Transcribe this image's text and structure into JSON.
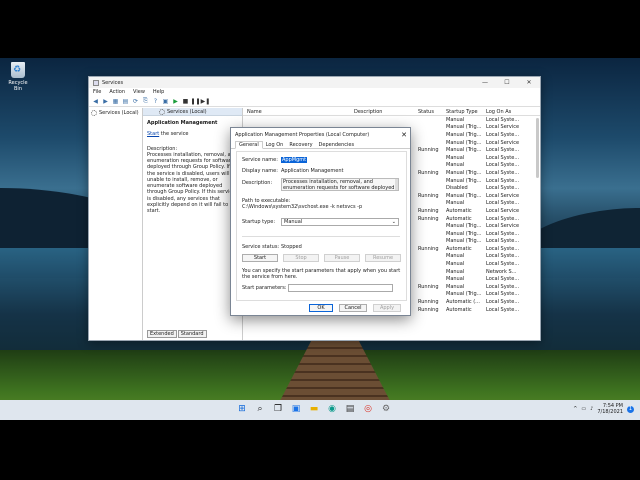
{
  "desktop": {
    "recycle_bin_label": "Recycle Bin"
  },
  "window": {
    "title": "Services",
    "controls": [
      "—",
      "☐",
      "✕"
    ],
    "menu": [
      "File",
      "Action",
      "View",
      "Help"
    ],
    "tree_item": "Services (Local)",
    "mid_header": "Services (Local)",
    "selected_service": "Application Management",
    "start_link": "Start",
    "start_suffix": " the service",
    "description_label": "Description:",
    "description_text": "Processes installation, removal, and enumeration requests for software deployed through Group Policy. If the service is disabled, users will be unable to install, remove, or enumerate software deployed through Group Policy. If this service is disabled, any services that explicitly depend on it will fail to start.",
    "bottom_tabs": [
      "Extended",
      "Standard"
    ],
    "columns": {
      "name": "Name",
      "description": "Description",
      "status": "Status",
      "startup": "Startup Type",
      "logon": "Log On As"
    },
    "rows": [
      {
        "name": "",
        "desc": "",
        "status": "",
        "startup": "Manual",
        "logon": "Local Syste..."
      },
      {
        "name": "",
        "desc": "",
        "status": "",
        "startup": "Manual (Trig...",
        "logon": "Local Service"
      },
      {
        "name": "",
        "desc": "",
        "status": "",
        "startup": "Manual (Trig...",
        "logon": "Local Syste..."
      },
      {
        "name": "",
        "desc": "",
        "status": "",
        "startup": "Manual (Trig...",
        "logon": "Local Service"
      },
      {
        "name": "",
        "desc": "",
        "status": "Running",
        "startup": "Manual (Trig...",
        "logon": "Local Syste..."
      },
      {
        "name": "",
        "desc": "",
        "status": "",
        "startup": "Manual",
        "logon": "Local Syste..."
      },
      {
        "name": "",
        "desc": "",
        "status": "",
        "startup": "Manual",
        "logon": "Local Syste..."
      },
      {
        "name": "",
        "desc": "",
        "status": "Running",
        "startup": "Manual (Trig...",
        "logon": "Local Syste..."
      },
      {
        "name": "",
        "desc": "",
        "status": "",
        "startup": "Manual (Trig...",
        "logon": "Local Syste..."
      },
      {
        "name": "",
        "desc": "",
        "status": "",
        "startup": "Disabled",
        "logon": "Local Syste..."
      },
      {
        "name": "",
        "desc": "",
        "status": "Running",
        "startup": "Manual (Trig...",
        "logon": "Local Service"
      },
      {
        "name": "",
        "desc": "",
        "status": "",
        "startup": "Manual",
        "logon": "Local Syste..."
      },
      {
        "name": "",
        "desc": "",
        "status": "Running",
        "startup": "Automatic",
        "logon": "Local Service"
      },
      {
        "name": "",
        "desc": "",
        "status": "Running",
        "startup": "Automatic",
        "logon": "Local Syste..."
      },
      {
        "name": "",
        "desc": "",
        "status": "",
        "startup": "Manual (Trig...",
        "logon": "Local Service"
      },
      {
        "name": "",
        "desc": "",
        "status": "",
        "startup": "Manual (Trig...",
        "logon": "Local Syste..."
      },
      {
        "name": "",
        "desc": "",
        "status": "",
        "startup": "Manual (Trig...",
        "logon": "Local Syste..."
      },
      {
        "name": "",
        "desc": "",
        "status": "Running",
        "startup": "Automatic",
        "logon": "Local Syste..."
      },
      {
        "name": "",
        "desc": "",
        "status": "",
        "startup": "Manual",
        "logon": "Local Syste..."
      },
      {
        "name": "",
        "desc": "",
        "status": "",
        "startup": "Manual",
        "logon": "Local Syste..."
      },
      {
        "name": "",
        "desc": "",
        "status": "",
        "startup": "Manual",
        "logon": "Network S..."
      },
      {
        "name": "",
        "desc": "",
        "status": "",
        "startup": "Manual",
        "logon": "Local Syste..."
      },
      {
        "name": "",
        "desc": "",
        "status": "Running",
        "startup": "Manual",
        "logon": "Local Syste..."
      },
      {
        "name": "",
        "desc": "",
        "status": "",
        "startup": "Manual (Trig...",
        "logon": "Local Syste..."
      },
      {
        "name": "",
        "desc": "This user service is ...",
        "status": "Running",
        "startup": "Automatic (...",
        "logon": "Local Syste..."
      },
      {
        "name": "CDPUserSvc_2fe3b",
        "desc": "This user service is ...",
        "status": "Running",
        "startup": "Automatic",
        "logon": "Local Syste..."
      }
    ]
  },
  "dialog": {
    "title": "Application Management Properties (Local Computer)",
    "tabs": [
      "General",
      "Log On",
      "Recovery",
      "Dependencies"
    ],
    "service_name_label": "Service name:",
    "service_name_value": "AppMgmt",
    "display_name_label": "Display name:",
    "display_name_value": "Application Management",
    "description_label": "Description:",
    "description_value": "Processes installation, removal, and enumeration requests for software deployed through Group Policy. If the service is disabled, users will be unable",
    "path_label": "Path to executable:",
    "path_value": "C:\\Windows\\system32\\svchost.exe -k netsvcs -p",
    "startup_label": "Startup type:",
    "startup_value": "Manual",
    "status_label": "Service status:",
    "status_value": "Stopped",
    "btn_start": "Start",
    "btn_stop": "Stop",
    "btn_pause": "Pause",
    "btn_resume": "Resume",
    "params_hint": "You can specify the start parameters that apply when you start the service from here.",
    "params_label": "Start parameters:",
    "btn_ok": "OK",
    "btn_cancel": "Cancel",
    "btn_apply": "Apply"
  },
  "taskbar": {
    "icons": [
      "windows-start-icon",
      "search-icon",
      "task-view-icon",
      "widgets-icon",
      "file-explorer-icon",
      "edge-icon",
      "store-icon",
      "chrome-icon",
      "services-icon"
    ],
    "time": "7:54 PM",
    "date": "7/18/2021",
    "notification_count": "1"
  }
}
